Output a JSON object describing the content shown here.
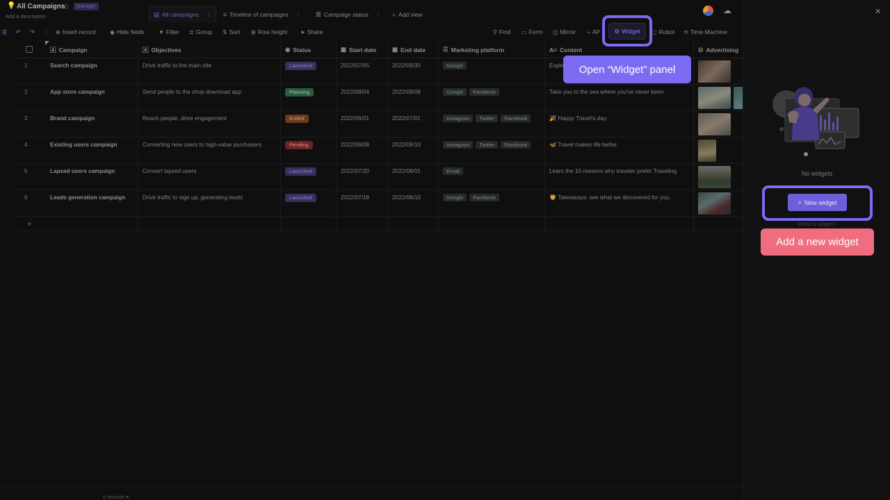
{
  "header": {
    "title": "All Campaigns",
    "role_badge": "Manager",
    "description": "Add a description"
  },
  "tabs": [
    {
      "label": "All campaigns",
      "icon": "grid-view-icon"
    },
    {
      "label": "Timeline of campaigns",
      "icon": "gantt-view-icon"
    },
    {
      "label": "Campaign status",
      "icon": "kanban-view-icon"
    },
    {
      "label": "Add view",
      "icon": "plus-icon"
    }
  ],
  "toolbar": {
    "insert": "Insert record",
    "hide": "Hide fields",
    "filter": "Filter",
    "group": "Group",
    "sort": "Sort",
    "row_height": "Row height",
    "share": "Share",
    "find": "Find",
    "form": "Form",
    "mirror": "Mirror",
    "api": "AP",
    "widget": "Widget",
    "robot": "Robot",
    "time_machine": "Time Machine"
  },
  "columns": [
    "Campaign",
    "Objectives",
    "Status",
    "Start date",
    "End date",
    "Marketing platform",
    "Content",
    "Advertising"
  ],
  "rows": [
    {
      "n": "1",
      "campaign": "Search campaign",
      "objective": "Drive traffic to the main site",
      "status": "Launched",
      "start": "2022/07/05",
      "end": "2022/09/30",
      "platforms": [
        "Google"
      ],
      "content": "Explo"
    },
    {
      "n": "2",
      "campaign": "App store campaign",
      "objective": "Send people to the shop download app",
      "status": "Planning",
      "start": "2022/08/04",
      "end": "2022/09/08",
      "platforms": [
        "Google",
        "Facebook"
      ],
      "content": "Take you to the sea where you've never been."
    },
    {
      "n": "3",
      "campaign": "Brand campaign",
      "objective": "Reach people, drive engagement",
      "status": "Ended",
      "start": "2022/06/01",
      "end": "2022/07/01",
      "platforms": [
        "Instagram",
        "Twitter",
        "Facebook"
      ],
      "content": "🎉 Happy Travel's day."
    },
    {
      "n": "4",
      "campaign": "Existing users campaign",
      "objective": "Converting new users to high-value purchasers",
      "status": "Pending",
      "start": "2022/08/08",
      "end": "2022/09/10",
      "platforms": [
        "Instagram",
        "Twitter",
        "Facebook"
      ],
      "content": "🦋 Travel makes life better."
    },
    {
      "n": "5",
      "campaign": "Lapsed users campaign",
      "objective": "Convert lapsed users",
      "status": "Launched",
      "start": "2022/07/20",
      "end": "2022/08/01",
      "platforms": [
        "Email"
      ],
      "content": "Learn the 10 reasons why traveler prefer Traveling."
    },
    {
      "n": "6",
      "campaign": "Leads generation campaign",
      "objective": "Drive traffic to sign up, generating leads",
      "status": "Launched",
      "start": "2022/07/18",
      "end": "2022/08/10",
      "platforms": [
        "Google",
        "Facebook"
      ],
      "content": "🦁 Takeaways: see what we discovered for you."
    }
  ],
  "status_colors": {
    "Launched": "#35325c",
    "Planning": "#2a5a40",
    "Ended": "#6a3a1e",
    "Pending": "#6a2424"
  },
  "status_text_colors": {
    "Launched": "#8d88c4",
    "Planning": "#8fcaa5",
    "Ended": "#d59a73",
    "Pending": "#e28c8c"
  },
  "footer": {
    "records": "6 records ▾"
  },
  "tooltip_widget": "Open “Widget” panel",
  "panel": {
    "empty": "No widgets",
    "new_widget": "New widget",
    "what": "What is widget?",
    "tooltip": "Add a new widget"
  }
}
